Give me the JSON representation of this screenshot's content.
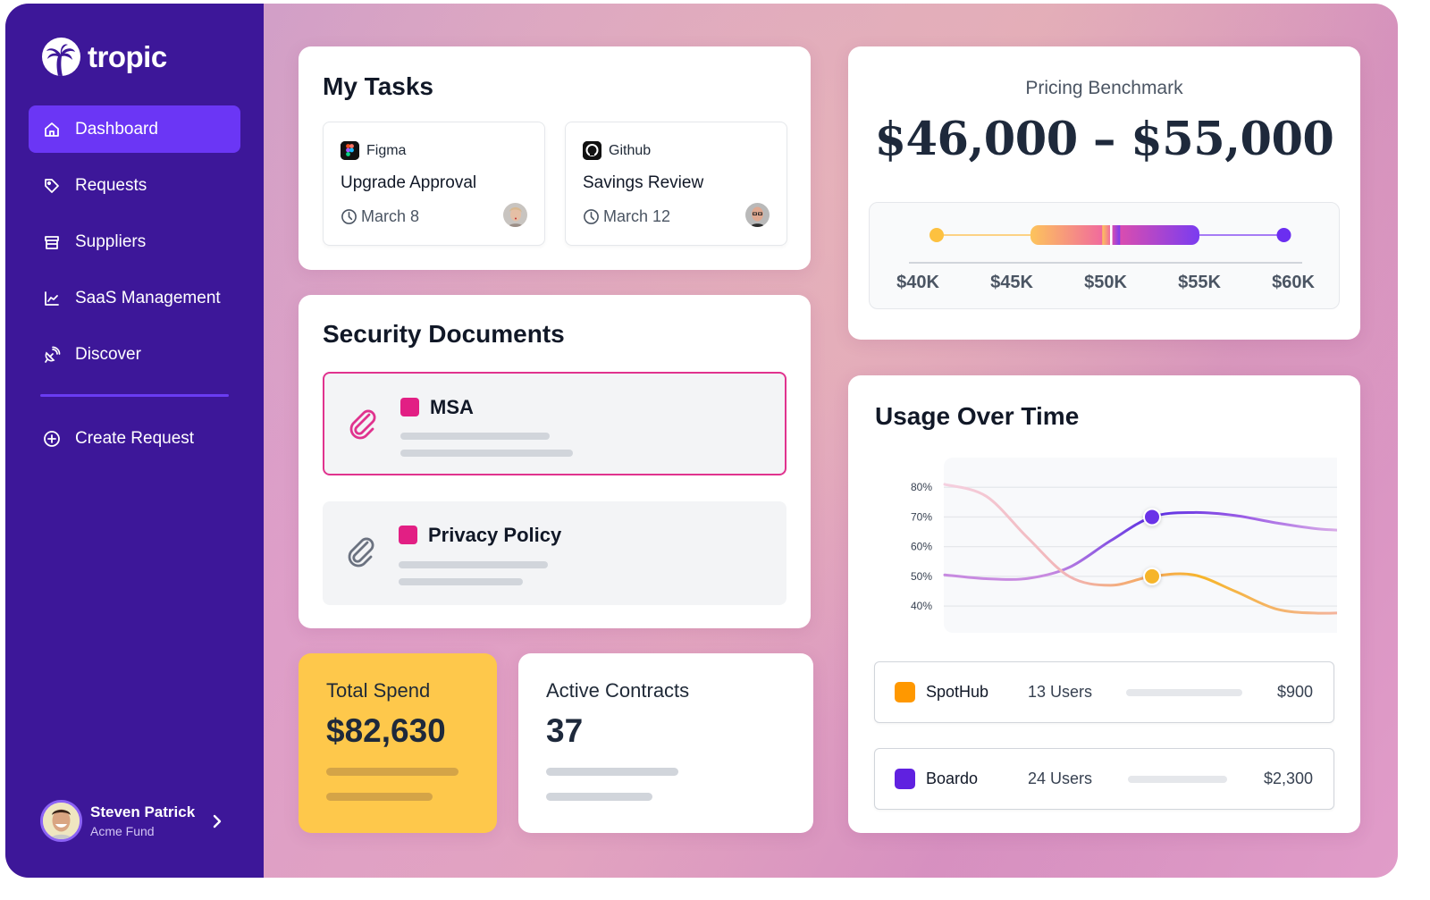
{
  "app": {
    "brand": "tropic"
  },
  "sidebar": {
    "items": [
      {
        "label": "Dashboard",
        "icon": "home-icon",
        "active": true
      },
      {
        "label": "Requests",
        "icon": "tag-icon",
        "active": false
      },
      {
        "label": "Suppliers",
        "icon": "store-icon",
        "active": false
      },
      {
        "label": "SaaS Management",
        "icon": "chart-line-icon",
        "active": false
      },
      {
        "label": "Discover",
        "icon": "satellite-dish-icon",
        "active": false
      }
    ],
    "create_request": {
      "label": "Create Request",
      "icon": "plus-circle-icon"
    },
    "user": {
      "name": "Steven Patrick",
      "org": "Acme Fund"
    }
  },
  "tasks": {
    "title": "My Tasks",
    "items": [
      {
        "app": "Figma",
        "title": "Upgrade Approval",
        "date": "March 8"
      },
      {
        "app": "Github",
        "title": "Savings Review",
        "date": "March 12"
      }
    ]
  },
  "security_docs": {
    "title": "Security Documents",
    "items": [
      {
        "title": "MSA",
        "selected": true
      },
      {
        "title": "Privacy Policy",
        "selected": false
      }
    ]
  },
  "total_spend": {
    "label": "Total Spend",
    "value": "$82,630"
  },
  "active_contracts": {
    "label": "Active Contracts",
    "value": "37"
  },
  "pricing": {
    "label": "Pricing Benchmark",
    "range_text": "$46,000 – $55,000",
    "axis_ticks": [
      "$40K",
      "$45K",
      "$50K",
      "$55K",
      "$60K"
    ],
    "axis_min": 40000,
    "axis_max": 60000,
    "whisker_low": 41000,
    "range_low": 46000,
    "median": 50300,
    "range_high": 55000,
    "whisker_high": 59500
  },
  "usage": {
    "title": "Usage Over Time",
    "legend": [
      {
        "name": "SpotHub",
        "users": "13 Users",
        "price": "$900",
        "color": "#ff9800"
      },
      {
        "name": "Boardo",
        "users": "24 Users",
        "price": "$2,300",
        "color": "#6021e0"
      }
    ]
  },
  "chart_data": {
    "type": "line",
    "title": "Usage Over Time",
    "ylabel": "",
    "xlabel": "",
    "yticks": [
      "80%",
      "70%",
      "60%",
      "50%",
      "40%"
    ],
    "ylim": [
      31,
      90
    ],
    "x": [
      0,
      1,
      2,
      3,
      4,
      5,
      6,
      7,
      8,
      9,
      10
    ],
    "grid": true,
    "highlight_index": 5,
    "series": [
      {
        "name": "Boardo",
        "color": "#6a33e8",
        "values": [
          50.5,
          49.2,
          49.3,
          53,
          62,
          70,
          71.5,
          70.5,
          68,
          66,
          65.3
        ]
      },
      {
        "name": "SpotHub",
        "color": "#f6b52a",
        "values": [
          81,
          77,
          63,
          50,
          47,
          50,
          50.5,
          45,
          39,
          37.6,
          38
        ]
      }
    ]
  }
}
